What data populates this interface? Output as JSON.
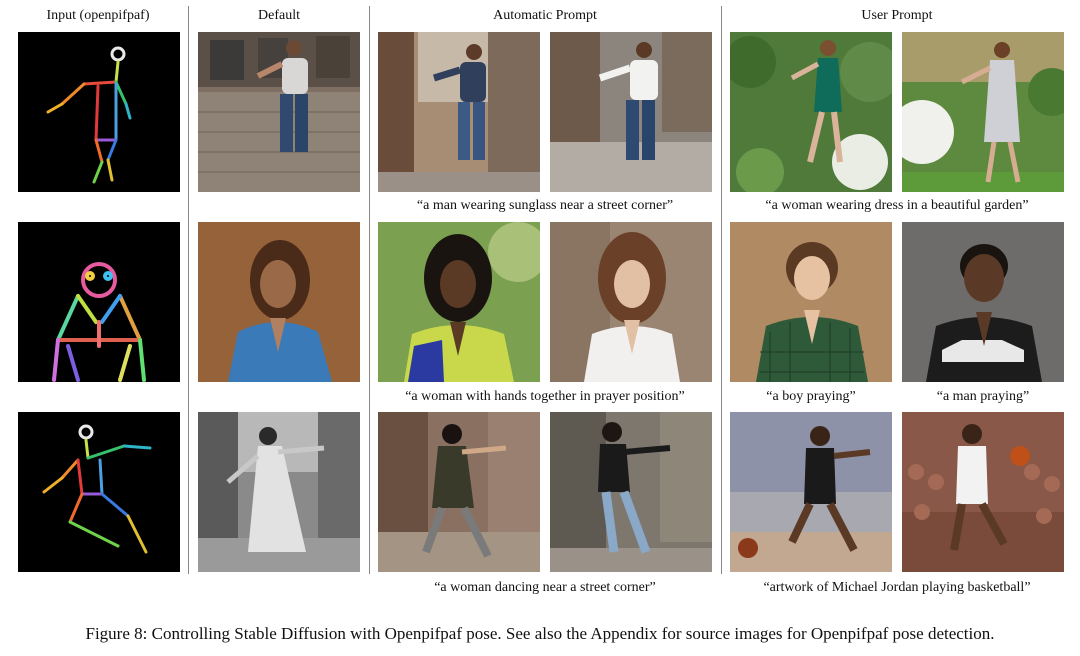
{
  "headers": {
    "input": "Input (openpifpaf)",
    "default": "Default",
    "automatic": "Automatic Prompt",
    "user": "User Prompt"
  },
  "captions": {
    "row1_auto": "“a man wearing sunglass near a street corner”",
    "row1_user": "“a woman wearing dress in a beautiful garden”",
    "row2_auto": "“a woman with hands together in prayer position”",
    "row2_user_a": "“a boy praying”",
    "row2_user_b": "“a man praying”",
    "row3_auto": "“a woman dancing near a street corner”",
    "row3_user": "“artwork of Michael Jordan playing basketball”"
  },
  "figure_caption": "Figure 8: Controlling Stable Diffusion with Openpifpaf pose. See also the Appendix for source images for Openpifpaf pose detection."
}
